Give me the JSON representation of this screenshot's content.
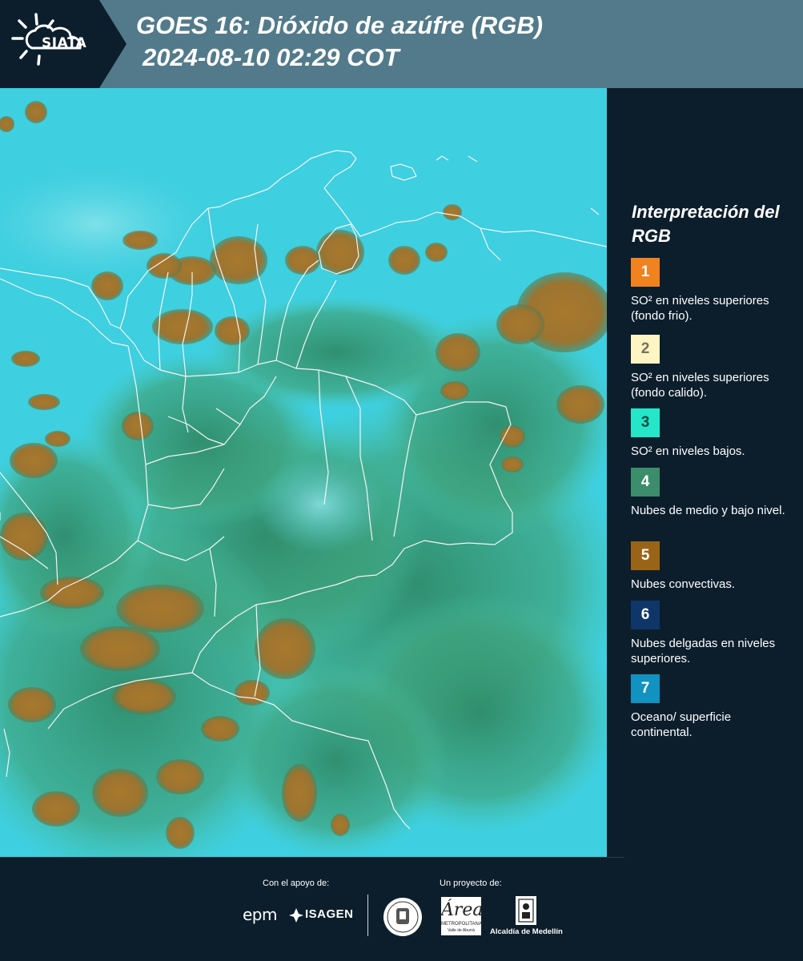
{
  "header": {
    "logo_text": "SIATA",
    "title_line1": "GOES 16: Dióxido de azúfre (RGB)",
    "title_line2": "2024-08-10 02:29 COT"
  },
  "legend": {
    "title": "Interpretación del RGB",
    "items": [
      {
        "number": "1",
        "label": "SO² en niveles superiores (fondo frio).",
        "color": "#f08220",
        "text_color": "#ffffff"
      },
      {
        "number": "2",
        "label": "SO² en niveles superiores (fondo calido).",
        "color": "#fff5c2",
        "text_color": "#7a7060"
      },
      {
        "number": "3",
        "label": "SO² en niveles bajos.",
        "color": "#25e6c8",
        "text_color": "#0c4a44"
      },
      {
        "number": "4",
        "label": "Nubes de medio y bajo nivel.",
        "color": "#3c8d6c",
        "text_color": "#ffffff"
      },
      {
        "number": "5",
        "label": "Nubes convectivas.",
        "color": "#9a6418",
        "text_color": "#ffffff"
      },
      {
        "number": "6",
        "label": "Nubes delgadas en niveles superiores.",
        "color": "#0f3668",
        "text_color": "#ffffff"
      },
      {
        "number": "7",
        "label": "Oceano/ superficie continental.",
        "color": "#1192c0",
        "text_color": "#ffffff"
      }
    ]
  },
  "footer": {
    "support_label": "Con el apoyo de:",
    "project_label": "Un proyecto de:",
    "sponsors": [
      "epm",
      "ISAGEN"
    ],
    "partners": {
      "area_word": "Área",
      "area_line1": "METROPOLITANA",
      "area_line2": "Valle de Aburrá",
      "alcaldia": "Alcaldía de Medellín"
    }
  },
  "map_colors": {
    "background": "#3ecfe0",
    "green": "#3c9a78",
    "convective": "#a8792e",
    "border": "#f4f4f4"
  }
}
